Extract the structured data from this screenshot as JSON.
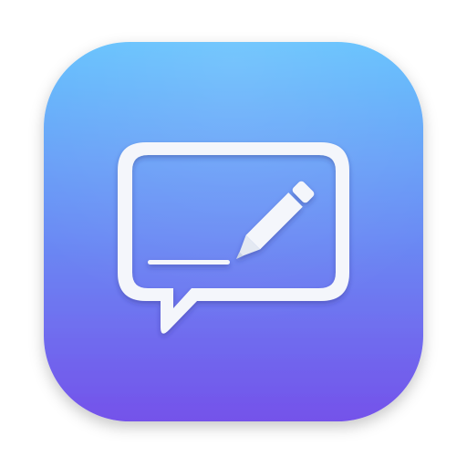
{
  "icon": {
    "semantic": "speech-bubble-with-pencil-icon",
    "colors": {
      "gradient_top": "#62c0fd",
      "gradient_bottom": "#7452ea",
      "glyph": "#ffffff",
      "glyph_shade": "#e6ebf4",
      "pencil_tip": "#dfe6f2"
    }
  }
}
